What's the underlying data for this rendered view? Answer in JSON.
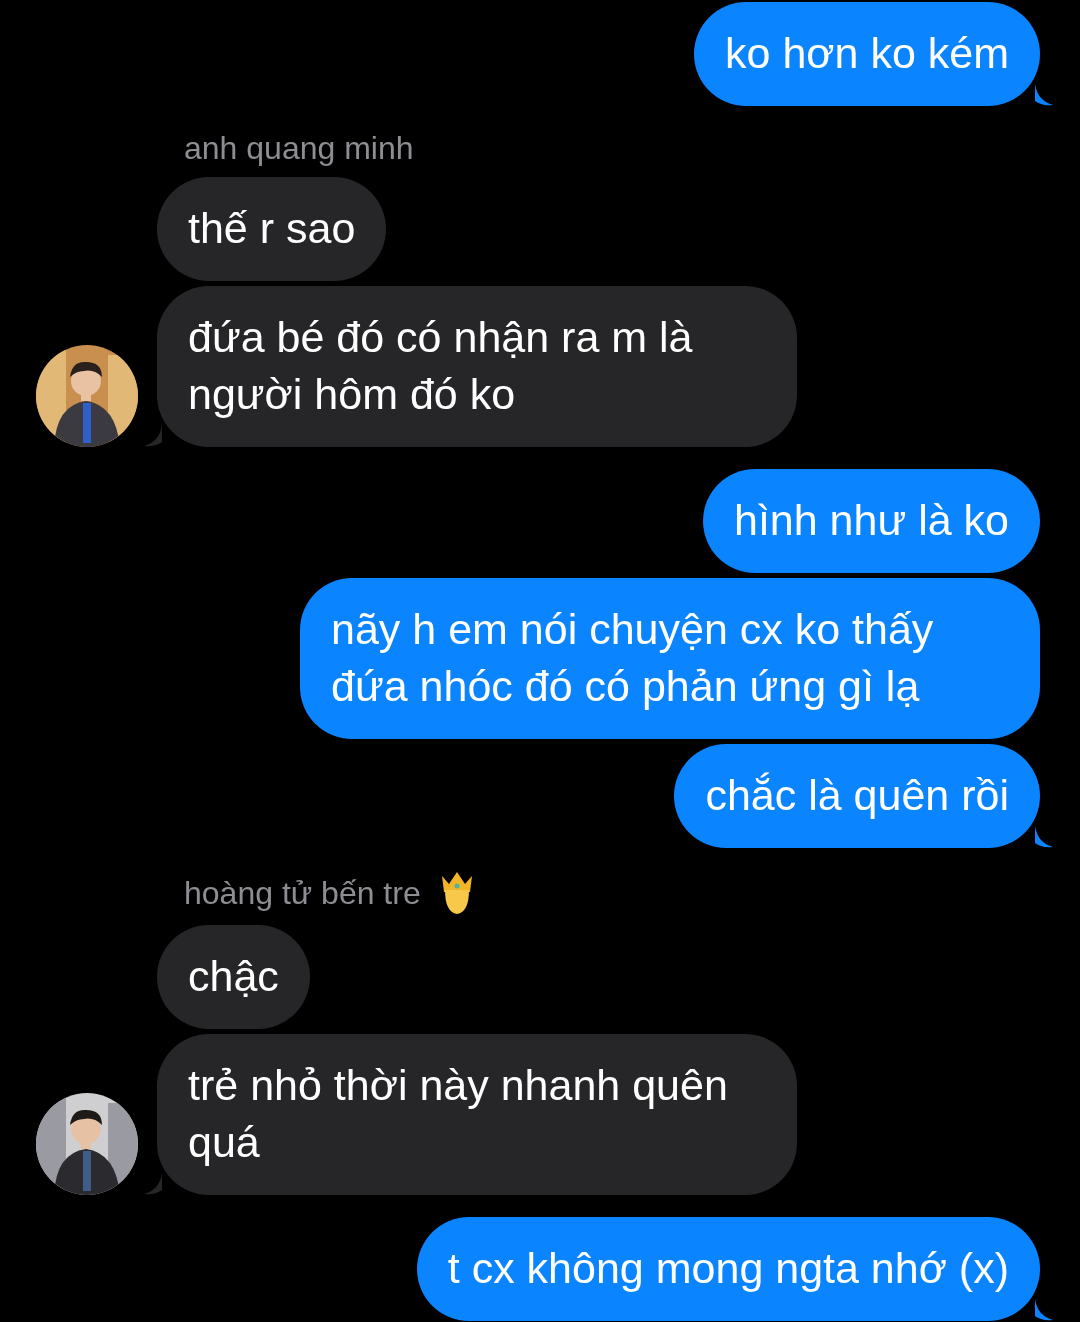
{
  "groups": [
    {
      "kind": "outgoing",
      "messages": [
        "ko hơn ko kém"
      ]
    },
    {
      "kind": "incoming",
      "sender": "anh quang minh",
      "badge": false,
      "messages": [
        "thế r sao",
        "đứa bé đó có nhận ra m là người hôm đó ko"
      ]
    },
    {
      "kind": "outgoing",
      "messages": [
        "hình như là ko",
        "nãy h em nói chuyện cx ko thấy đứa nhóc đó có phản ứng gì lạ",
        "chắc là quên rồi"
      ]
    },
    {
      "kind": "incoming",
      "sender": "hoàng tử bến tre",
      "badge": true,
      "messages": [
        "chậc",
        "trẻ nhỏ thời này nhanh quên quá"
      ]
    },
    {
      "kind": "outgoing",
      "messages": [
        "t cx không mong ngta nhớ (x)"
      ]
    }
  ]
}
